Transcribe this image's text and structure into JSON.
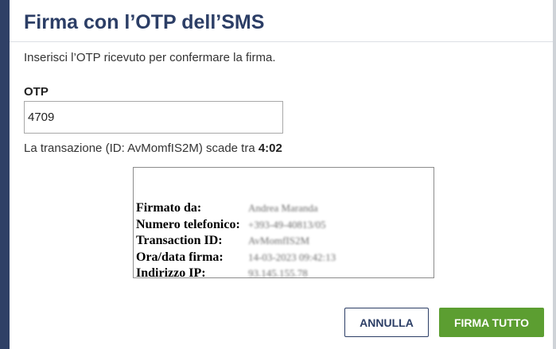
{
  "dialog": {
    "title": "Firma con l’OTP dell’SMS",
    "instructions": "Inserisci l’OTP ricevuto per confermare la firma.",
    "otp_label": "OTP",
    "otp_value": "4709",
    "expiry_prefix": "La transazione (ID: AvMomfIS2M) scade tra ",
    "expiry_time": "4:02"
  },
  "signature_preview": {
    "rows": [
      {
        "label": "Firmato da:",
        "value": "Andrea Maranda"
      },
      {
        "label": "Numero telefonico:",
        "value": "+393-49-40813/05"
      },
      {
        "label": "Transaction ID:",
        "value": "AvMomfIS2M"
      },
      {
        "label": "Ora/data firma:",
        "value": "14-03-2023 09:42:13"
      },
      {
        "label": "Indirizzo IP:",
        "value": "93.145.155.78"
      }
    ]
  },
  "buttons": {
    "cancel": "ANNULLA",
    "sign_all": "FIRMA TUTTO"
  },
  "colors": {
    "title": "#2c3e66",
    "sidebar": "#2f4066",
    "primary_button": "#5c9e31"
  }
}
